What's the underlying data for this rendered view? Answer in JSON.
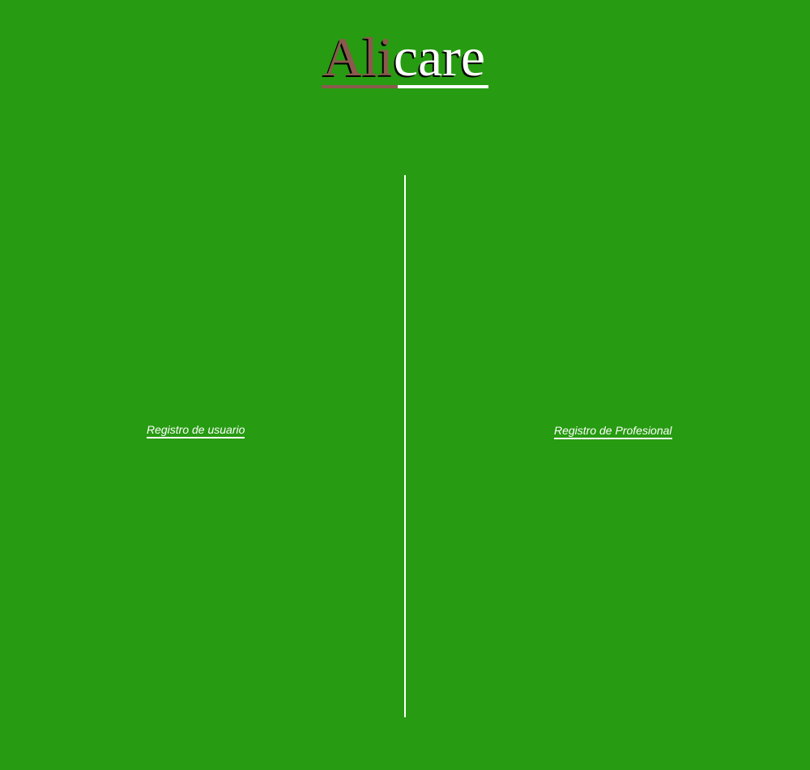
{
  "logo": {
    "part_a": "Ali",
    "part_b": "care"
  },
  "links": {
    "user_registration": "Registro de usuario",
    "professional_registration": "Registro de Profesional"
  },
  "colors": {
    "background": "#279b12",
    "logo_accent": "#8a5a4d",
    "text": "#ffffff"
  }
}
